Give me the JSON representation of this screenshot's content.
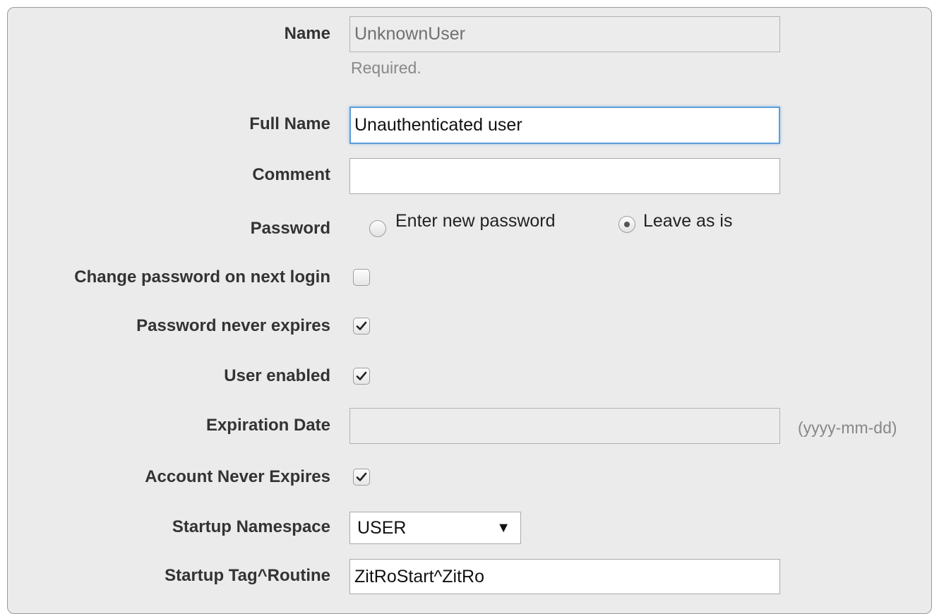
{
  "form": {
    "name": {
      "label": "Name",
      "value": "UnknownUser",
      "hint": "Required."
    },
    "full_name": {
      "label": "Full Name",
      "value": "Unauthenticated user"
    },
    "comment": {
      "label": "Comment",
      "value": ""
    },
    "password": {
      "label": "Password",
      "options": [
        "Enter new password",
        "Leave as is"
      ],
      "selected": "Leave as is"
    },
    "change_password_next_login": {
      "label": "Change password on next login",
      "checked": false
    },
    "password_never_expires": {
      "label": "Password never expires",
      "checked": true
    },
    "user_enabled": {
      "label": "User enabled",
      "checked": true
    },
    "expiration_date": {
      "label": "Expiration Date",
      "value": "",
      "format_hint": "(yyyy-mm-dd)"
    },
    "account_never_expires": {
      "label": "Account Never Expires",
      "checked": true
    },
    "startup_namespace": {
      "label": "Startup Namespace",
      "selected": "USER"
    },
    "startup_tag_routine": {
      "label": "Startup Tag^Routine",
      "value": "ZitRoStart^ZitRo"
    }
  },
  "colors": {
    "panel_background": "#ebebeb",
    "focus_border": "#5b9dd9",
    "disabled_field": "#ececec",
    "hint_text": "#888888"
  }
}
